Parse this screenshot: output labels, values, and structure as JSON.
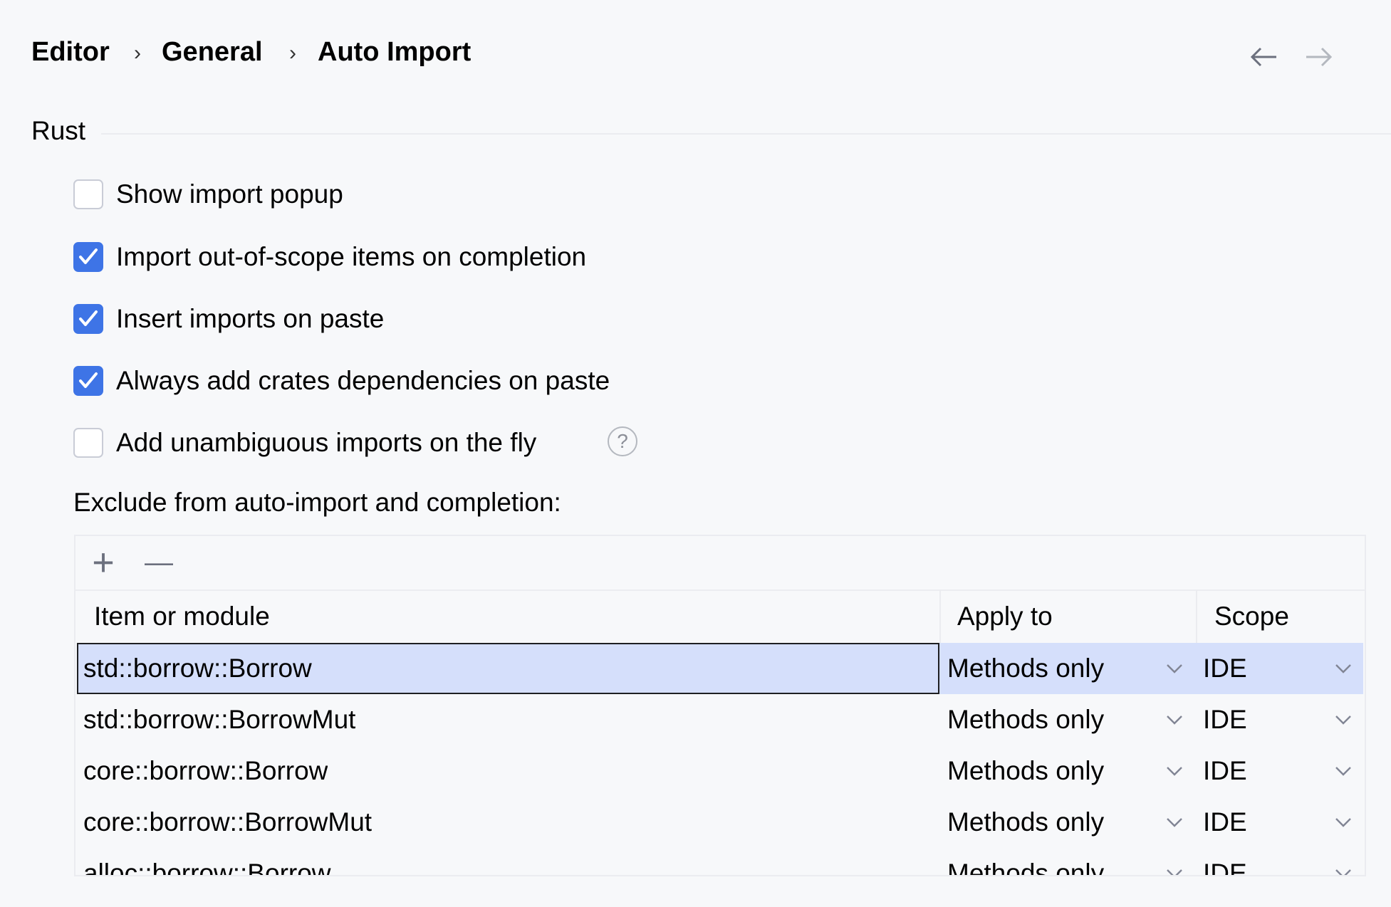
{
  "breadcrumb": {
    "items": [
      "Editor",
      "General",
      "Auto Import"
    ],
    "separator": "›"
  },
  "nav": {
    "back": "back-arrow",
    "forward": "forward-arrow"
  },
  "section": {
    "title": "Rust"
  },
  "options": [
    {
      "label": "Show import popup",
      "checked": false
    },
    {
      "label": "Import out-of-scope items on completion",
      "checked": true
    },
    {
      "label": "Insert imports on paste",
      "checked": true
    },
    {
      "label": "Always add crates dependencies on paste",
      "checked": true
    },
    {
      "label": "Add unambiguous imports on the fly",
      "checked": false
    }
  ],
  "help_icon": "?",
  "exclude": {
    "label": "Exclude from auto-import and completion:",
    "toolbar": {
      "add": "+",
      "remove": "—"
    },
    "columns": [
      "Item or module",
      "Apply to",
      "Scope"
    ],
    "rows": [
      {
        "item": "std::borrow::Borrow",
        "apply": "Methods only",
        "scope": "IDE"
      },
      {
        "item": "std::borrow::BorrowMut",
        "apply": "Methods only",
        "scope": "IDE"
      },
      {
        "item": "core::borrow::Borrow",
        "apply": "Methods only",
        "scope": "IDE"
      },
      {
        "item": "core::borrow::BorrowMut",
        "apply": "Methods only",
        "scope": "IDE"
      },
      {
        "item": "alloc::borrow::Borrow",
        "apply": "Methods only",
        "scope": "IDE"
      }
    ]
  },
  "colors": {
    "accent": "#3e74e6",
    "selection": "#d5dffb",
    "background": "#f7f8fa"
  }
}
